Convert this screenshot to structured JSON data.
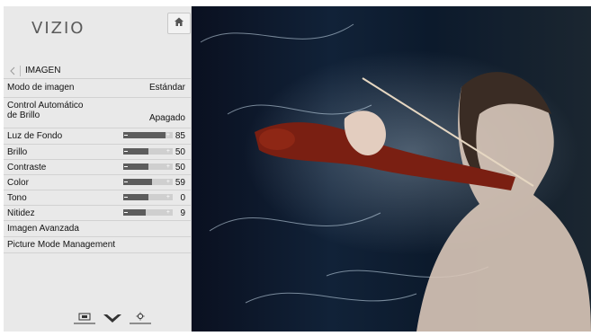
{
  "brand": {
    "logo_text": "VIZIO"
  },
  "menu": {
    "breadcrumb": "IMAGEN",
    "rows": [
      {
        "label": "Modo de imagen",
        "value": "Estándar"
      },
      {
        "label": "Control Automático\nde Brillo",
        "value": "Apagado"
      },
      {
        "label": "Luz de Fondo",
        "value": "85",
        "level": 0.85
      },
      {
        "label": "Brillo",
        "value": "50",
        "level": 0.5
      },
      {
        "label": "Contraste",
        "value": "50",
        "level": 0.5
      },
      {
        "label": "Color",
        "value": "59",
        "level": 0.59
      },
      {
        "label": "Tono",
        "value": "0",
        "level": 0.5
      },
      {
        "label": "Nitidez",
        "value": "9",
        "level": 0.45
      },
      {
        "label": "Imagen Avanzada"
      },
      {
        "label": "Picture Mode Management"
      }
    ]
  },
  "icons": {
    "home": "home-icon",
    "back": "back-arrow-icon",
    "input": "input-icon",
    "vizio_v": "vizio-v-icon",
    "settings": "settings-gear-icon"
  },
  "colors": {
    "panel_bg": "#e9e9e9",
    "slider_fill": "#5d5d5d",
    "slider_track": "#cfcfcf",
    "video_bg": "#0c1a2c"
  }
}
